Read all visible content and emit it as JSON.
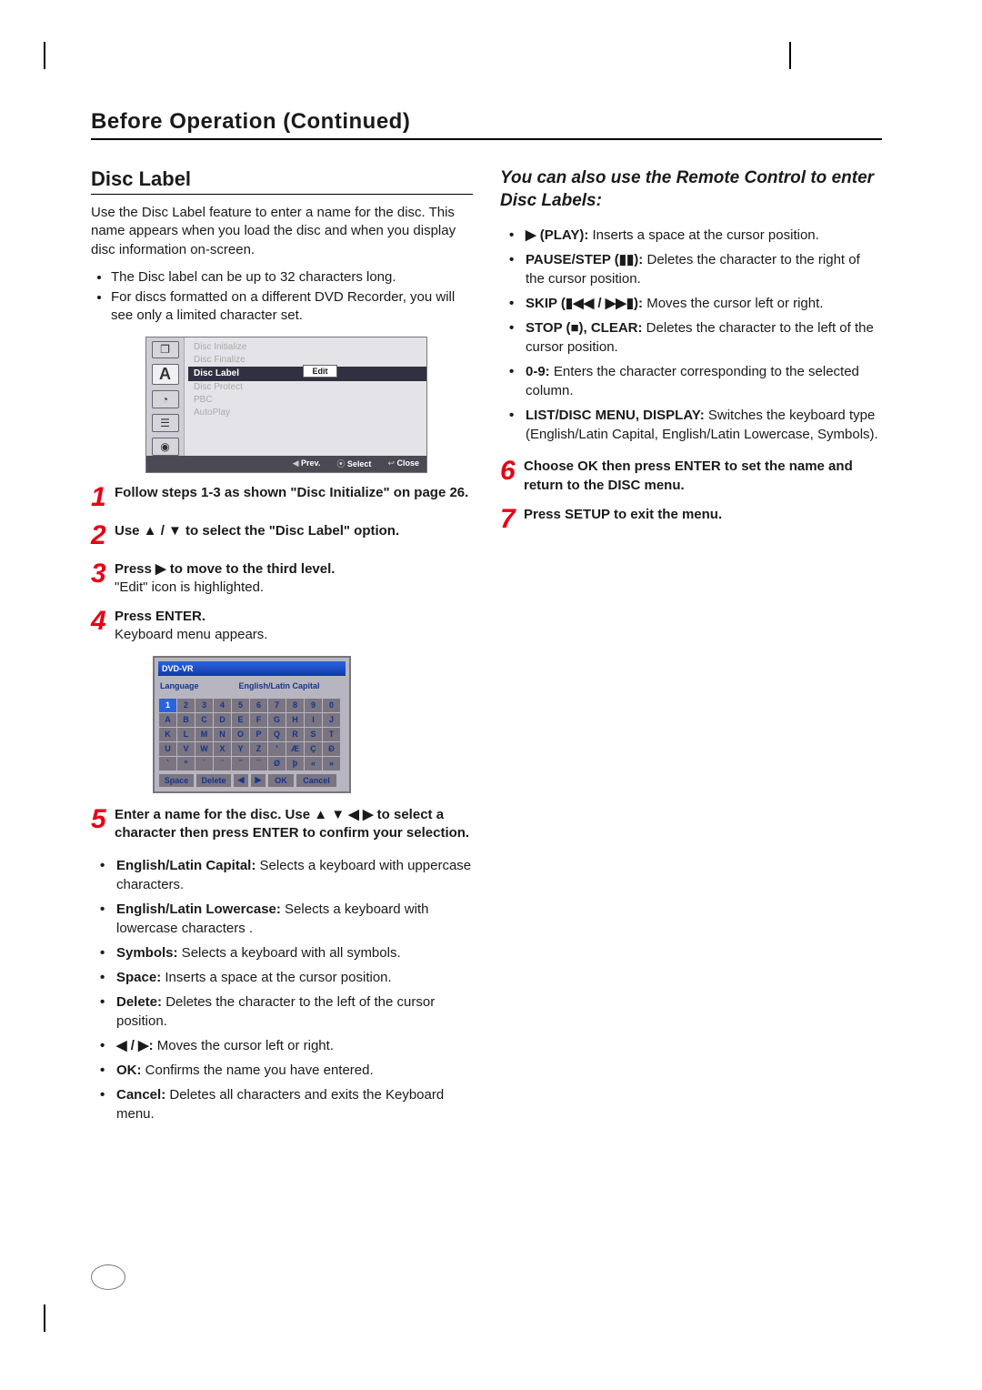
{
  "page": {
    "title": "Before Operation (Continued)"
  },
  "left": {
    "heading": "Disc Label",
    "intro": "Use the Disc Label feature to enter a name for the disc. This name appears when you load the disc and when you display disc information on-screen.",
    "intro_bullets": [
      "The Disc label can be up to 32 characters long.",
      "For discs formatted on a different DVD Recorder, you will see only a limited character set."
    ],
    "menu_shot": {
      "rail_label": "A",
      "items": [
        {
          "label": "Disc Initialize",
          "active": false
        },
        {
          "label": "Disc Finalize",
          "active": false
        },
        {
          "label": "Disc Label",
          "active": true
        },
        {
          "label": "Disc Protect",
          "active": false
        },
        {
          "label": "PBC",
          "active": false
        },
        {
          "label": "AutoPlay",
          "active": false
        }
      ],
      "edit_button": "Edit",
      "footer_prev": "Prev.",
      "footer_select": "Select",
      "footer_close": "Close"
    },
    "steps": {
      "s1": {
        "num": "1",
        "bold": "Follow steps 1-3 as shown \"Disc Initialize\" on page 26."
      },
      "s2": {
        "num": "2",
        "bold": "Use ▲ / ▼ to select the \"Disc Label\" option."
      },
      "s3": {
        "num": "3",
        "bold": "Press ▶ to move to the third level.",
        "rest": "\"Edit\" icon is highlighted."
      },
      "s4": {
        "num": "4",
        "bold": "Press ENTER.",
        "rest": "Keyboard menu appears."
      },
      "s5": {
        "num": "5",
        "bold": "Enter a name for the disc. Use ▲ ▼ ◀ ▶ to select a character then press ENTER to confirm your selection."
      }
    },
    "keyboard_shot": {
      "title": "DVD-VR",
      "lang_label": "Language",
      "mode_label": "English/Latin Capital",
      "rows": [
        [
          "1",
          "2",
          "3",
          "4",
          "5",
          "6",
          "7",
          "8",
          "9",
          "0"
        ],
        [
          "A",
          "B",
          "C",
          "D",
          "E",
          "F",
          "G",
          "H",
          "I",
          "J"
        ],
        [
          "K",
          "L",
          "M",
          "N",
          "O",
          "P",
          "Q",
          "R",
          "S",
          "T"
        ],
        [
          "U",
          "V",
          "W",
          "X",
          "Y",
          "Z",
          "'",
          "Æ",
          "Ç",
          "Ð"
        ],
        [
          "`",
          "º",
          "˙",
          "¨",
          "˝",
          "¯",
          "Ø",
          "þ",
          "«",
          "»"
        ]
      ],
      "actions": {
        "space": "Space",
        "delete": "Delete",
        "left": "◀",
        "right": "▶",
        "ok": "OK",
        "cancel": "Cancel"
      }
    },
    "s5_bullets": [
      {
        "bold": "English/Latin Capital:",
        "rest": " Selects a keyboard with uppercase characters."
      },
      {
        "bold": "English/Latin Lowercase:",
        "rest": " Selects a keyboard with lowercase characters ."
      },
      {
        "bold": "Symbols:",
        "rest": " Selects a keyboard with all symbols."
      },
      {
        "bold": "Space:",
        "rest": " Inserts a space at the cursor position."
      },
      {
        "bold": "Delete:",
        "rest": " Deletes the character to the left of the cursor position."
      },
      {
        "bold": "◀ / ▶:",
        "rest": " Moves the cursor left or right."
      },
      {
        "bold": "OK:",
        "rest": " Confirms the name you have entered."
      },
      {
        "bold": "Cancel:",
        "rest": " Deletes all characters and exits the Keyboard menu."
      }
    ]
  },
  "right": {
    "alt_heading": "You can also use the Remote Control to enter Disc Labels:",
    "bullets": [
      {
        "bold": "▶ (PLAY):",
        "rest": " Inserts a space at the cursor position."
      },
      {
        "bold": "PAUSE/STEP (▮▮):",
        "rest": " Deletes the character to the right of the cursor position."
      },
      {
        "bold": "SKIP (▮◀◀ / ▶▶▮):",
        "rest": " Moves the cursor left or right."
      },
      {
        "bold": "STOP (■), CLEAR:",
        "rest": " Deletes the character to the left of the cursor position."
      },
      {
        "bold": "0-9:",
        "rest": " Enters the character corresponding to the selected column."
      },
      {
        "bold": "LIST/DISC MENU, DISPLAY:",
        "rest": " Switches the keyboard type (English/Latin Capital, English/Latin Lowercase, Symbols)."
      }
    ],
    "steps": {
      "s6": {
        "num": "6",
        "bold": "Choose OK then press ENTER to set the name and return to the DISC menu."
      },
      "s7": {
        "num": "7",
        "bold": "Press SETUP to exit the menu."
      }
    }
  }
}
